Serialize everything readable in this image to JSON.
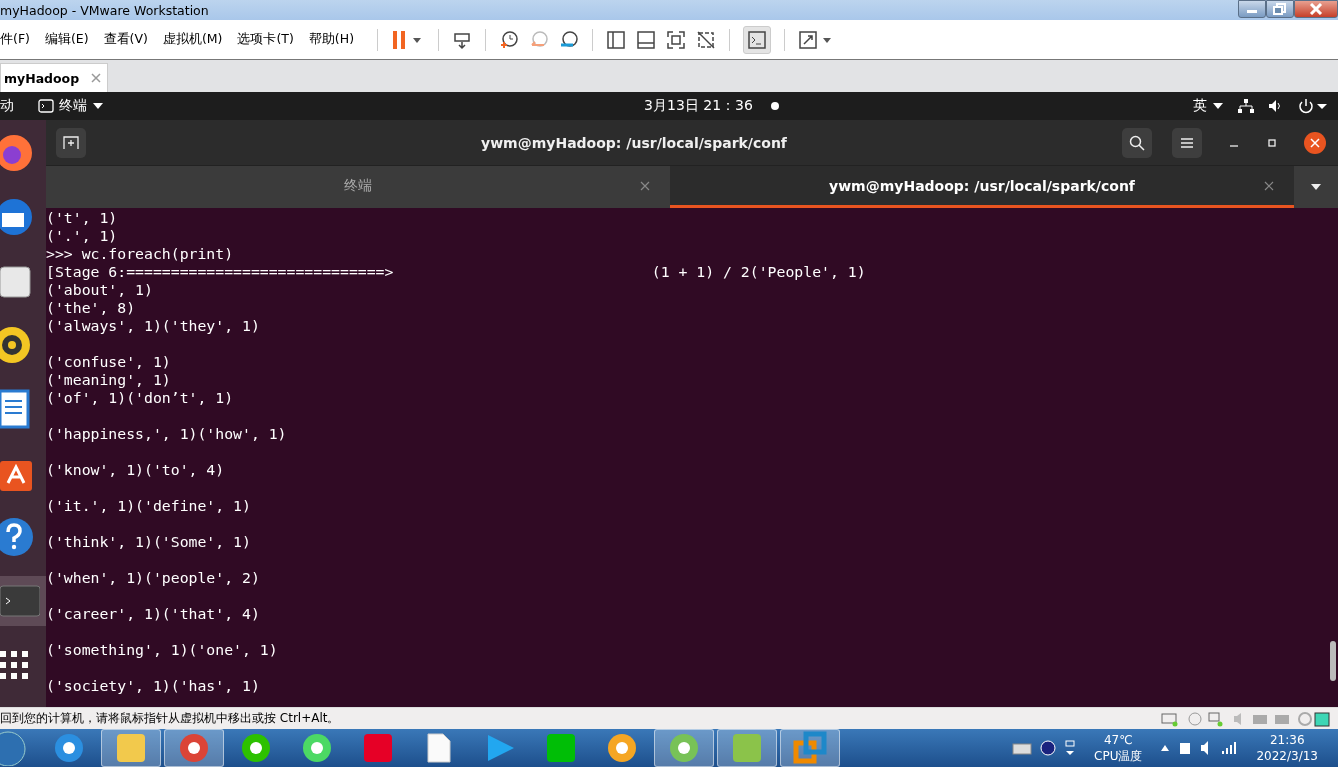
{
  "window": {
    "title": "myHadoop - VMware Workstation"
  },
  "menu": [
    "件(F)",
    "编辑(E)",
    "查看(V)",
    "虚拟机(M)",
    "选项卡(T)",
    "帮助(H)"
  ],
  "vm_tabs": [
    {
      "label": "myHadoop",
      "selected": true
    }
  ],
  "gnome_bar": {
    "activities": "动",
    "app_menu": "终端",
    "clock": "3月13日  21：36",
    "input_method": "英"
  },
  "dock": [
    {
      "kind": "firefox",
      "active": false
    },
    {
      "kind": "mail",
      "active": false
    },
    {
      "kind": "files",
      "active": false
    },
    {
      "kind": "music",
      "active": false
    },
    {
      "kind": "writer",
      "active": false
    },
    {
      "kind": "store",
      "active": false
    },
    {
      "kind": "help",
      "active": false
    },
    {
      "kind": "terminal",
      "active": true
    },
    {
      "kind": "grid",
      "active": false
    }
  ],
  "terminal": {
    "title": "ywm@myHadoop: /usr/local/spark/conf",
    "tabs": [
      {
        "label": "终端",
        "selected": false
      },
      {
        "label": "ywm@myHadoop: /usr/local/spark/conf",
        "selected": true
      }
    ],
    "lines": [
      {
        "text": "('t', 1)",
        "blank_after": false
      },
      {
        "text": "('.', 1)",
        "blank_after": false
      },
      {
        "text": ">>> wc.foreach(print)",
        "blank_after": false
      },
      {
        "text": "[Stage 6:=============================>                             (1 + 1) / 2('People', 1)",
        "blank_after": false
      },
      {
        "text": "('about', 1)",
        "blank_after": false
      },
      {
        "text": "('the', 8)",
        "blank_after": false
      },
      {
        "text": "('always', 1)('they', 1)",
        "blank_after": true
      },
      {
        "text": "('confuse', 1)",
        "blank_after": false
      },
      {
        "text": "('meaning', 1)",
        "blank_after": false
      },
      {
        "text": "('of', 1)('don’t', 1)",
        "blank_after": true
      },
      {
        "text": "('happiness,', 1)('how', 1)",
        "blank_after": true
      },
      {
        "text": "('know', 1)('to', 4)",
        "blank_after": true
      },
      {
        "text": "('it.', 1)('define', 1)",
        "blank_after": true
      },
      {
        "text": "('think', 1)('Some', 1)",
        "blank_after": true
      },
      {
        "text": "('when', 1)('people', 2)",
        "blank_after": true
      },
      {
        "text": "('career', 1)('that', 4)",
        "blank_after": true
      },
      {
        "text": "('something', 1)('one', 1)",
        "blank_after": true
      },
      {
        "text": "('society', 1)('has', 1)",
        "blank_after": false
      }
    ]
  },
  "status_bar": {
    "message": "回到您的计算机，请将鼠标指针从虚拟机中移出或按 Ctrl+Alt。"
  },
  "taskbar": {
    "apps": [
      {
        "kind": "ie",
        "open": false
      },
      {
        "kind": "folder",
        "open": true
      },
      {
        "kind": "chrome",
        "open": true
      },
      {
        "kind": "chat",
        "open": false
      },
      {
        "kind": "cup",
        "open": false
      },
      {
        "kind": "music",
        "open": false
      },
      {
        "kind": "file",
        "open": false
      },
      {
        "kind": "video",
        "open": false
      },
      {
        "kind": "tv",
        "open": false
      },
      {
        "kind": "cat",
        "open": false
      },
      {
        "kind": "android",
        "open": true
      },
      {
        "kind": "notepad",
        "open": true
      },
      {
        "kind": "vmware",
        "open": true
      }
    ],
    "temperature": "47℃",
    "temperature_label": "CPU温度",
    "time": "21:36",
    "date": "2022/3/13"
  }
}
